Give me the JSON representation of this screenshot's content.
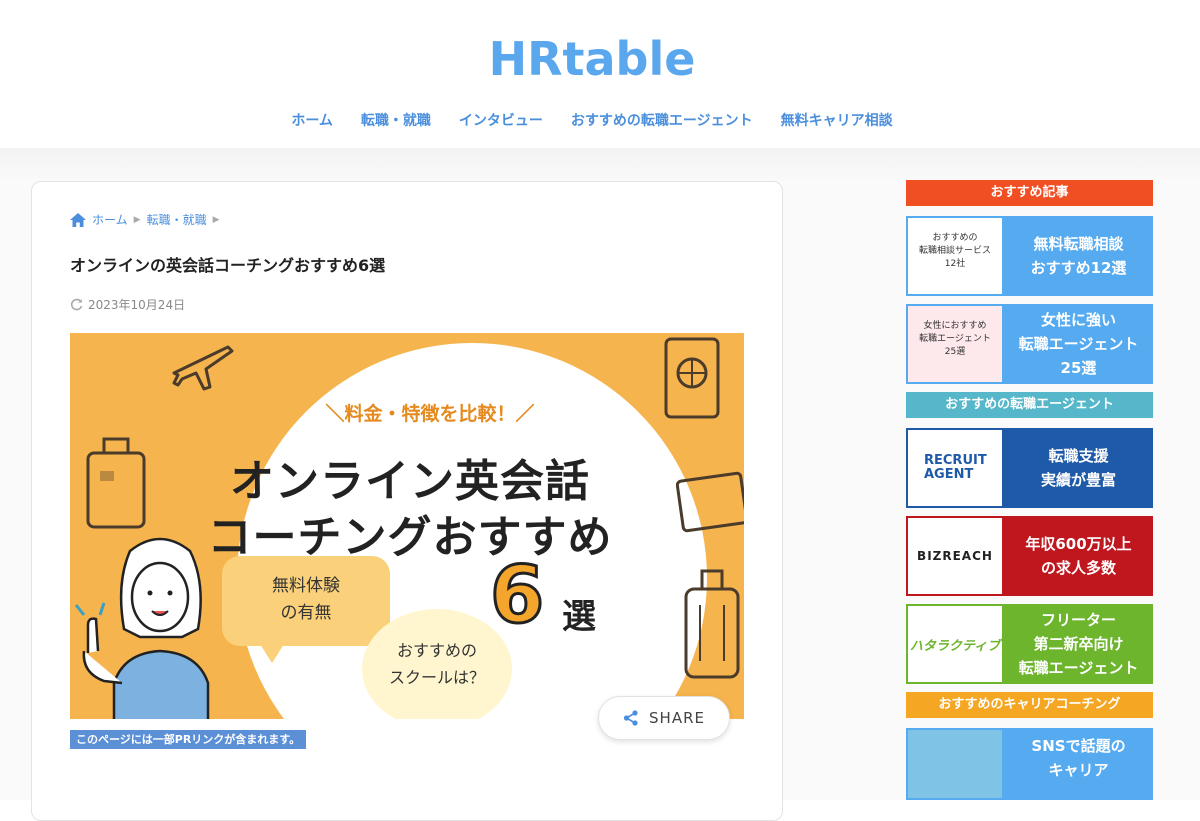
{
  "site": {
    "logo": "HRtable",
    "nav": [
      "ホーム",
      "転職・就職",
      "インタビュー",
      "おすすめの転職エージェント",
      "無料キャリア相談"
    ]
  },
  "article": {
    "breadcrumb": [
      "ホーム",
      "転職・就職"
    ],
    "title": "オンラインの英会話コーチングおすすめ6選",
    "date": "2023年10月24日",
    "hero": {
      "sub": "＼料金・特徴を比較！／",
      "line1": "オンライン英会話",
      "line2": "コーチングおすすめ",
      "number": "6",
      "suffix": "選",
      "bubble1": "無料体験\nの有無",
      "bubble2": "おすすめの\nスクールは？"
    },
    "pr_note": "このページには一部PRリンクが含まれます。",
    "share_label": "SHARE"
  },
  "sidebar": {
    "sections": [
      {
        "title": "おすすめ記事",
        "color": "#f04e23"
      },
      {
        "title": "おすすめの転職エージェント",
        "color": "#55b7c9"
      },
      {
        "title": "おすすめのキャリアコーチング",
        "color": "#f5a623"
      }
    ],
    "cards": [
      {
        "text": "無料転職相談\nおすすめ12選",
        "color": "#55aaf0",
        "thumb": "おすすめの\n転職相談サービス\n12社"
      },
      {
        "text": "女性に強い\n転職エージェント\n25選",
        "color": "#55aaf0",
        "thumb": "女性におすすめ\n転職エージェント\n25選"
      },
      {
        "text": "転職支援\n実績が豊富",
        "color": "#1f5aa8",
        "brand": "RECRUIT\nAGENT"
      },
      {
        "text": "年収600万以上\nの求人多数",
        "color": "#c0161e",
        "brand": "BIZREACH"
      },
      {
        "text": "フリーター\n第二新卒向け\n転職エージェント",
        "color": "#6cb52d",
        "brand": "ハタラクティブ"
      },
      {
        "text": "SNSで話題の\nキャリア",
        "color": "#55aaf0",
        "thumb": ""
      }
    ]
  }
}
